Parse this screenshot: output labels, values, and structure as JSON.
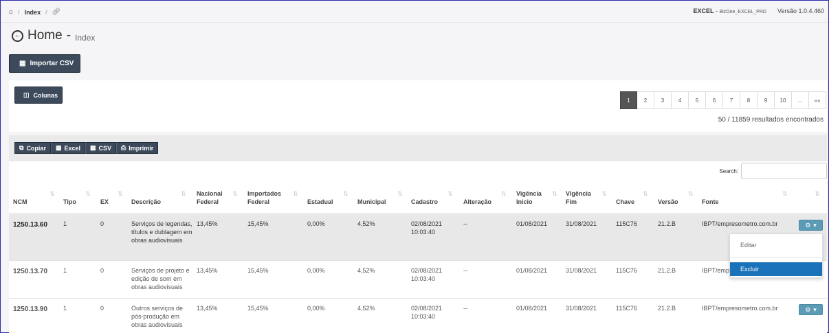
{
  "breadcrumb": {
    "home_icon": "home-icon",
    "items": [
      "Index"
    ],
    "link_icon": "link-icon"
  },
  "header": {
    "app": "EXCEL",
    "env": "BizOne_EXCEL_PRD",
    "version": "Versão 1.0.4.460"
  },
  "page": {
    "title": "Home",
    "subtitle": "Index",
    "back_icon": "arrow-left-circle-icon"
  },
  "toolbar": {
    "import_label": "Importar CSV",
    "columns_label": "Colunas"
  },
  "pagination": {
    "pages": [
      "1",
      "2",
      "3",
      "4",
      "5",
      "6",
      "7",
      "8",
      "9",
      "10",
      "...",
      "»»"
    ],
    "active": "1"
  },
  "results_text": "50 / 11859 resultados encontrados",
  "export": {
    "copy": "Copiar",
    "excel": "Excel",
    "csv": "CSV",
    "print": "Imprimir"
  },
  "search": {
    "label": "Search:",
    "value": ""
  },
  "table": {
    "headers": [
      {
        "key": "ncm",
        "line1": "",
        "line2": "NCM"
      },
      {
        "key": "tipo",
        "line1": "",
        "line2": "Tipo"
      },
      {
        "key": "ex",
        "line1": "",
        "line2": "EX"
      },
      {
        "key": "descricao",
        "line1": "",
        "line2": "Descrição"
      },
      {
        "key": "nacional",
        "line1": "Nacional",
        "line2": "Federal"
      },
      {
        "key": "importados",
        "line1": "Importados",
        "line2": "Federal"
      },
      {
        "key": "estadual",
        "line1": "",
        "line2": "Estadual"
      },
      {
        "key": "municipal",
        "line1": "",
        "line2": "Municipal"
      },
      {
        "key": "cadastro",
        "line1": "",
        "line2": "Cadastro"
      },
      {
        "key": "alteracao",
        "line1": "",
        "line2": "Alteração"
      },
      {
        "key": "vig_inicio",
        "line1": "Vigência",
        "line2": "Inicio"
      },
      {
        "key": "vig_fim",
        "line1": "Vigência",
        "line2": "Fim"
      },
      {
        "key": "chave",
        "line1": "",
        "line2": "Chave"
      },
      {
        "key": "versao",
        "line1": "",
        "line2": "Versão"
      },
      {
        "key": "fonte",
        "line1": "",
        "line2": "Fonte"
      }
    ],
    "rows": [
      {
        "ncm": "1250.13.60",
        "tipo": "1",
        "ex": "0",
        "descricao": "Serviços de legendas, títulos e dublagem em obras audiovisuais",
        "nacional": "13,45%",
        "importados": "15,45%",
        "estadual": "0,00%",
        "municipal": "4,52%",
        "cadastro": "02/08/2021 10:03:40",
        "alteracao": "--",
        "vig_inicio": "01/08/2021",
        "vig_fim": "31/08/2021",
        "chave": "115C76",
        "versao": "21.2.B",
        "fonte": "IBPT/empresometro.com.br"
      },
      {
        "ncm": "1250.13.70",
        "tipo": "1",
        "ex": "0",
        "descricao": "Serviços de projeto e edição de som em obras audiovisuais",
        "nacional": "13,45%",
        "importados": "15,45%",
        "estadual": "0,00%",
        "municipal": "4,52%",
        "cadastro": "02/08/2021 10:03:40",
        "alteracao": "--",
        "vig_inicio": "01/08/2021",
        "vig_fim": "31/08/2021",
        "chave": "115C76",
        "versao": "21.2.B",
        "fonte": "IBPT/empresometro.com.br"
      },
      {
        "ncm": "1250.13.90",
        "tipo": "1",
        "ex": "0",
        "descricao": "Outros serviços de pós-produção em obras audiovisuais",
        "nacional": "13,45%",
        "importados": "15,45%",
        "estadual": "0,00%",
        "municipal": "4,52%",
        "cadastro": "02/08/2021 10:03:40",
        "alteracao": "--",
        "vig_inicio": "01/08/2021",
        "vig_fim": "31/08/2021",
        "chave": "115C76",
        "versao": "21.2.B",
        "fonte": "IBPT/empresometro.com.br"
      }
    ]
  },
  "row_menu": {
    "edit": "Editar",
    "delete": "Excluir"
  }
}
